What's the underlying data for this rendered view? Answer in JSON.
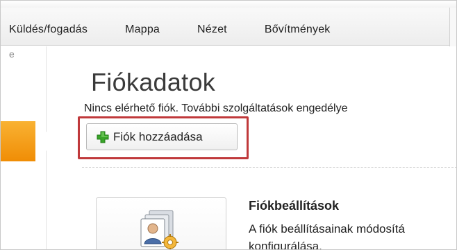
{
  "ribbon": {
    "tabs": [
      {
        "label": "Küldés/fogadás"
      },
      {
        "label": "Mappa"
      },
      {
        "label": "Nézet"
      },
      {
        "label": "Bővítmények"
      }
    ]
  },
  "sidebar": {
    "clipped_label": "e"
  },
  "main": {
    "title": "Fiókadatok",
    "no_account_message": "Nincs elérhető fiók. További szolgáltatások engedélye",
    "add_account_button": {
      "label": "Fiók hozzáadása",
      "icon": "plus-icon"
    },
    "account_settings": {
      "title": "Fiókbeállítások",
      "description_line1": "A fiók beállításainak módosítá",
      "description_line2": "konfigurálása.",
      "icon": "account-settings-icon"
    }
  },
  "colors": {
    "accent_orange": "#f08d05",
    "highlight_red": "#c0393b",
    "plus_green": "#3aa52a"
  }
}
